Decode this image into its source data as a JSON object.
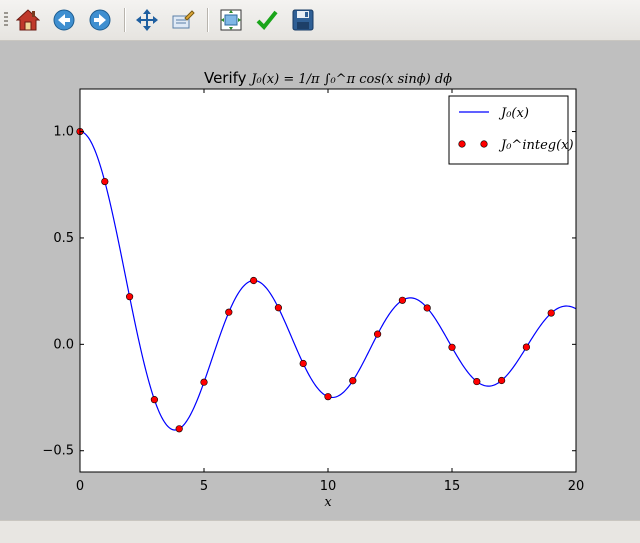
{
  "toolbar": {
    "buttons": [
      {
        "name": "home-button",
        "icon": "home-icon"
      },
      {
        "name": "back-button",
        "icon": "back-arrow-icon"
      },
      {
        "name": "forward-button",
        "icon": "forward-arrow-icon"
      },
      {
        "name": "pan-button",
        "icon": "move-arrows-icon"
      },
      {
        "name": "zoom-button",
        "icon": "zoom-rect-icon"
      },
      {
        "name": "subplots-button",
        "icon": "subplots-icon"
      },
      {
        "name": "edit-axes-button",
        "icon": "checkmark-icon"
      },
      {
        "name": "save-button",
        "icon": "floppy-disk-icon"
      }
    ]
  },
  "chart_data": {
    "type": "line",
    "title_prefix": "Verify",
    "title_math": "J₀(x) = 1/π ∫₀^π cos(x sinϕ) dϕ",
    "xlabel": "x",
    "ylabel": "",
    "xlim": [
      0,
      20
    ],
    "ylim": [
      -0.6,
      1.2
    ],
    "xticks": [
      "0",
      "5",
      "10",
      "15",
      "20"
    ],
    "yticks": [
      "−0.5",
      "0.0",
      "0.5",
      "1.0"
    ],
    "xtick_values": [
      0,
      5,
      10,
      15,
      20
    ],
    "ytick_values": [
      -0.5,
      0.0,
      0.5,
      1.0
    ],
    "grid": false,
    "legend_position": "top-right",
    "series": [
      {
        "name": "J₀(x)",
        "style": "line",
        "color": "#0000ff",
        "function": "bessel_j0",
        "x_range": [
          0,
          20
        ]
      },
      {
        "name": "J₀^integ(x)",
        "style": "points",
        "color": "#ff0000",
        "x": [
          0,
          1,
          2,
          3,
          4,
          5,
          6,
          7,
          8,
          9,
          10,
          11,
          12,
          13,
          14,
          15,
          16,
          17,
          18,
          19
        ],
        "y": [
          1.0,
          0.765,
          0.224,
          -0.26,
          -0.397,
          -0.178,
          0.151,
          0.3,
          0.172,
          -0.09,
          -0.246,
          -0.171,
          0.048,
          0.207,
          0.171,
          -0.014,
          -0.175,
          -0.17,
          -0.013,
          0.147
        ]
      }
    ]
  }
}
